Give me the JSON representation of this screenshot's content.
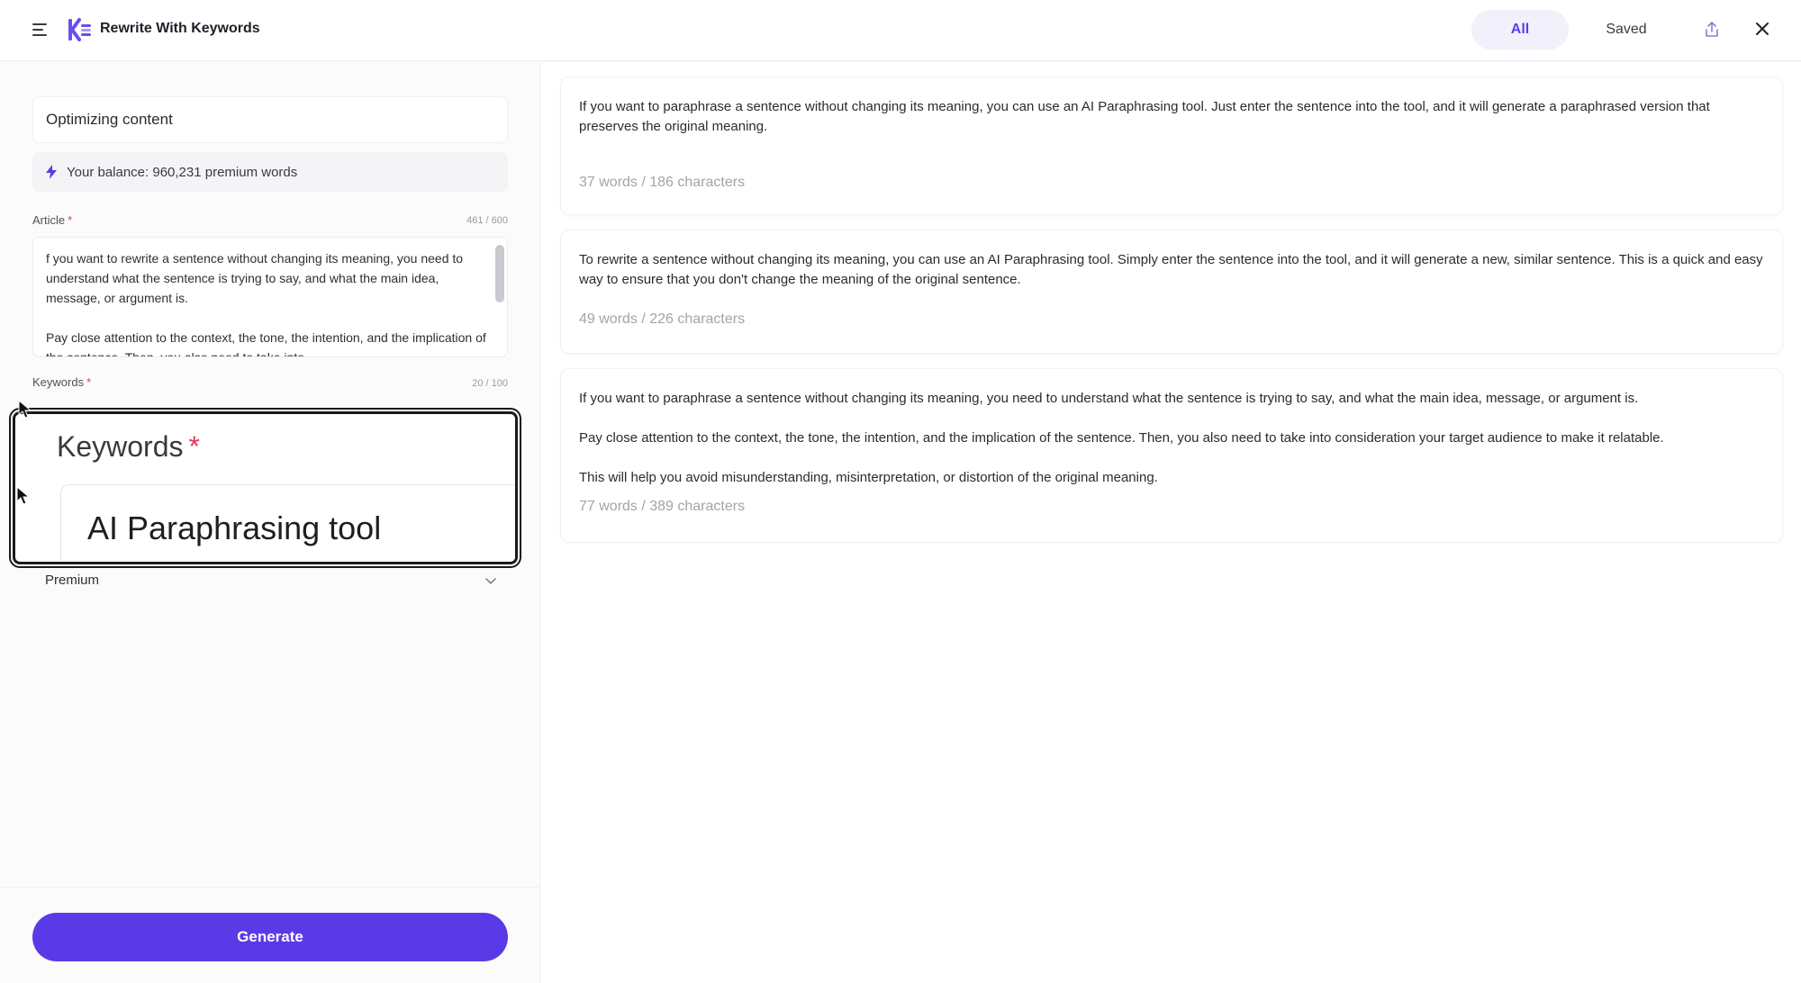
{
  "header": {
    "app_title": "Rewrite With Keywords",
    "tabs": [
      {
        "label": "All",
        "active": true
      },
      {
        "label": "Saved",
        "active": false
      }
    ]
  },
  "form": {
    "title_value": "Optimizing content",
    "balance_text": "Your balance: 960,231 premium words",
    "article": {
      "label": "Article",
      "required_mark": "*",
      "counter": "461 / 600",
      "value": "f you want to rewrite a sentence without changing its meaning, you need to understand what the sentence is trying to say, and what the main idea, message, or argument is.\n\nPay close attention to the context, the tone, the intention, and the implication of the sentence. Then, you also need to take into"
    },
    "keywords": {
      "label": "Keywords",
      "required_mark": "*",
      "counter": "20 / 100",
      "value": "AI Paraphrasing tool"
    },
    "quality": {
      "selected": "Premium"
    },
    "generate_label": "Generate"
  },
  "results": [
    {
      "paragraphs": [
        "If you want to paraphrase a sentence without changing its meaning, you can use an AI Paraphrasing tool. Just enter the sentence into the tool, and it will generate a paraphrased version that preserves the original meaning."
      ],
      "meta": "37 words / 186 characters"
    },
    {
      "paragraphs": [
        "To rewrite a sentence without changing its meaning, you can use an AI Paraphrasing tool. Simply enter the sentence into the tool, and it will generate a new, similar sentence. This is a quick and easy way to ensure that you don't change the meaning of the original sentence."
      ],
      "meta": "49 words / 226 characters"
    },
    {
      "paragraphs": [
        "If you want to paraphrase a sentence without changing its meaning, you need to understand what the sentence is trying to say, and what the main idea, message, or argument is.",
        "Pay close attention to the context, the tone, the intention, and the implication of the sentence. Then, you also need to take into consideration your target audience to make it relatable.",
        "This will help you avoid misunderstanding, misinterpretation, or distortion of the original meaning."
      ],
      "meta": "77 words / 389 characters"
    }
  ],
  "colors": {
    "accent": "#5a3ae6",
    "active_tab_bg": "#f1f0fb",
    "required": "#e23b57"
  },
  "icons": {
    "menu": "hamburger-menu-icon",
    "logo": "keywords-logo-icon",
    "balance": "lightning-bolt-icon",
    "share": "share-upload-icon",
    "close": "close-x-icon",
    "dropdown": "chevron-down-icon"
  }
}
